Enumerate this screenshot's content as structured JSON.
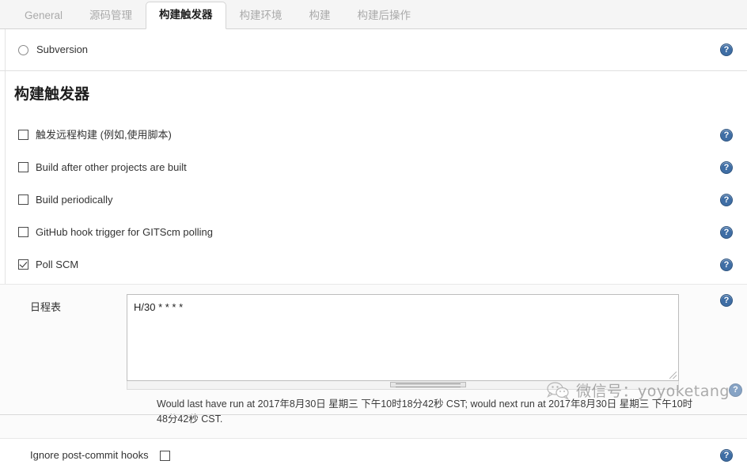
{
  "tabs": [
    {
      "label": "General",
      "active": false
    },
    {
      "label": "源码管理",
      "active": false
    },
    {
      "label": "构建触发器",
      "active": true
    },
    {
      "label": "构建环境",
      "active": false
    },
    {
      "label": "构建",
      "active": false
    },
    {
      "label": "构建后操作",
      "active": false
    }
  ],
  "scm": {
    "subversion_label": "Subversion"
  },
  "section": {
    "heading": "构建触发器"
  },
  "triggers": [
    {
      "label": "触发远程构建 (例如,使用脚本)",
      "checked": false
    },
    {
      "label": "Build after other projects are built",
      "checked": false
    },
    {
      "label": "Build periodically",
      "checked": false
    },
    {
      "label": "GitHub hook trigger for GITScm polling",
      "checked": false
    },
    {
      "label": "Poll SCM",
      "checked": true
    }
  ],
  "schedule": {
    "label": "日程表",
    "value": "H/30 * * * *",
    "placeholder": "",
    "status": "Would last have run at 2017年8月30日 星期三 下午10时18分42秒 CST; would next run at 2017年8月30日 星期三 下午10时48分42秒 CST."
  },
  "ignore_hooks": {
    "label": "Ignore post-commit hooks",
    "checked": false
  },
  "help": {
    "glyph": "?"
  },
  "watermark": {
    "text": "微信号：yoyoketang",
    "badge_glyph": "?"
  },
  "colors": {
    "accent": "#3f6ea5",
    "tabbar_bg": "#f5f5f5",
    "border": "#d4d4d4",
    "nested_bg": "#fbfbfb"
  }
}
